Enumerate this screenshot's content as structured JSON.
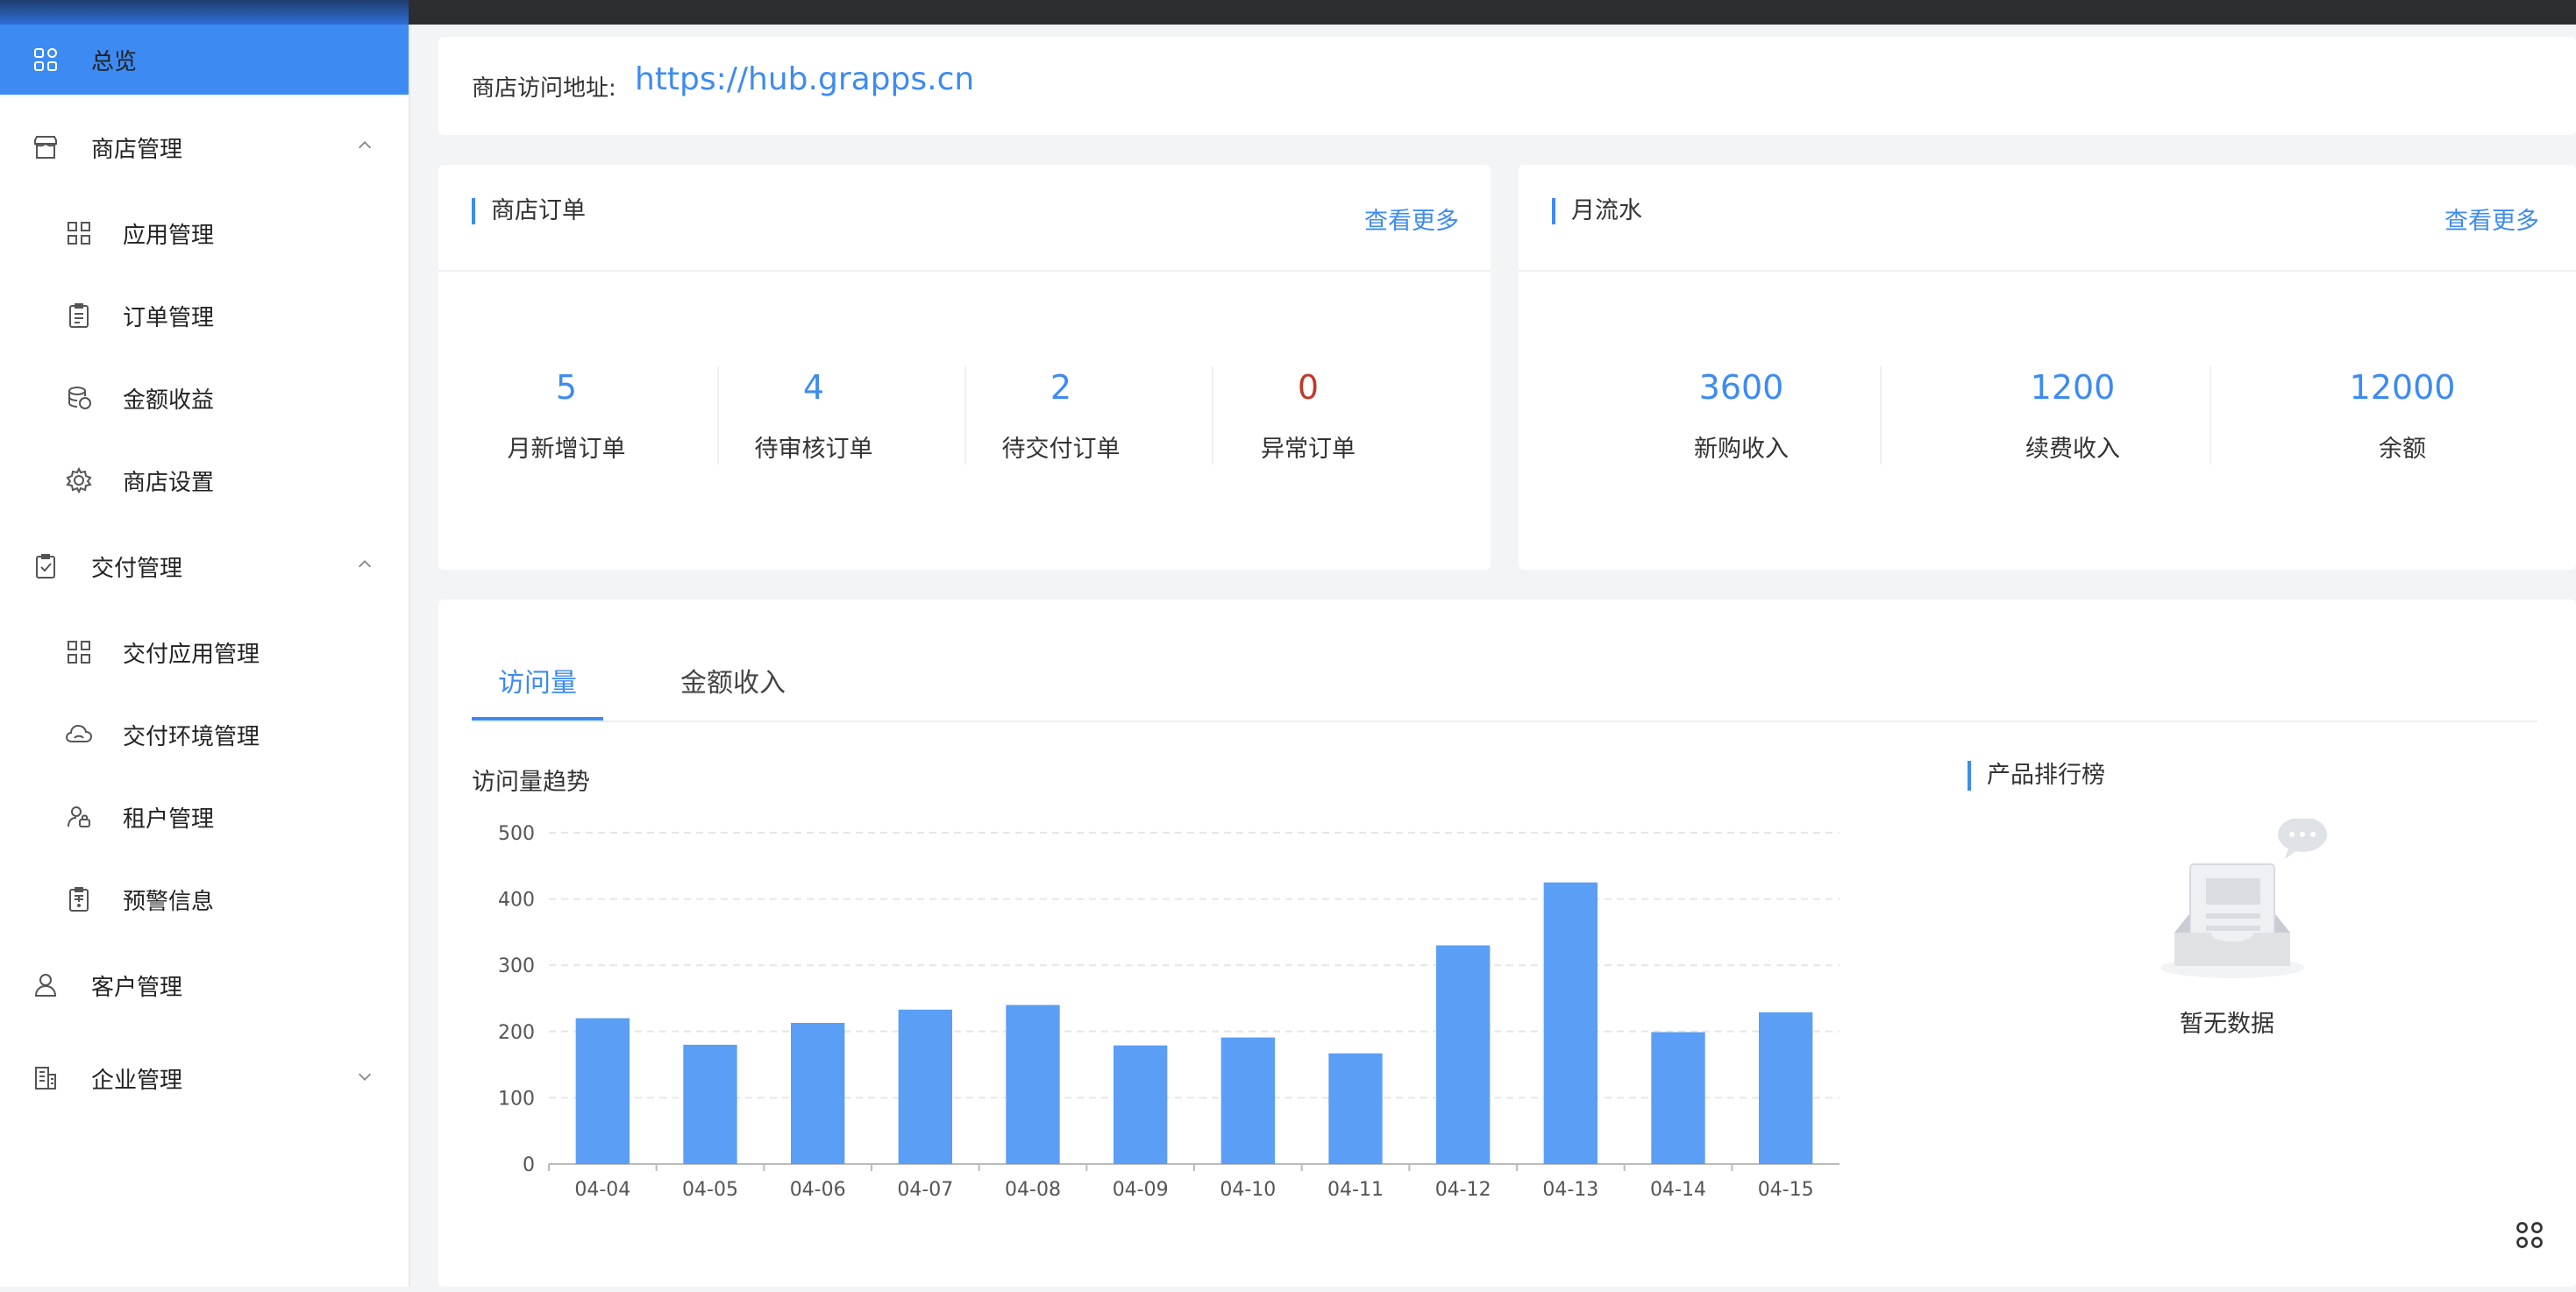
{
  "sidebar": {
    "items": [
      {
        "label": "总览",
        "icon": "overview-icon",
        "active": true
      },
      {
        "label": "商店管理",
        "icon": "store-icon",
        "expanded": true
      },
      {
        "label": "应用管理",
        "icon": "apps-icon"
      },
      {
        "label": "订单管理",
        "icon": "order-icon"
      },
      {
        "label": "金额收益",
        "icon": "coins-icon"
      },
      {
        "label": "商店设置",
        "icon": "gear-icon"
      },
      {
        "label": "交付管理",
        "icon": "delivery-icon",
        "expanded": true
      },
      {
        "label": "交付应用管理",
        "icon": "apps-icon"
      },
      {
        "label": "交付环境管理",
        "icon": "cloud-icon"
      },
      {
        "label": "租户管理",
        "icon": "tenant-icon"
      },
      {
        "label": "预警信息",
        "icon": "alert-icon"
      },
      {
        "label": "客户管理",
        "icon": "customer-icon"
      },
      {
        "label": "企业管理",
        "icon": "building-icon",
        "expanded": false
      }
    ]
  },
  "store_url": {
    "label": "商店访问地址:",
    "url": "https://hub.grapps.cn"
  },
  "orders_card": {
    "title": "商店订单",
    "more": "查看更多",
    "stats": [
      {
        "value": "5",
        "label": "月新增订单"
      },
      {
        "value": "4",
        "label": "待审核订单"
      },
      {
        "value": "2",
        "label": "待交付订单"
      },
      {
        "value": "0",
        "label": "异常订单"
      }
    ]
  },
  "flow_card": {
    "title": "月流水",
    "more": "查看更多",
    "stats": [
      {
        "value": "3600",
        "label": "新购收入"
      },
      {
        "value": "1200",
        "label": "续费收入"
      },
      {
        "value": "12000",
        "label": "余额"
      }
    ]
  },
  "tabs": [
    {
      "label": "访问量",
      "active": true
    },
    {
      "label": "金额收入",
      "active": false
    }
  ],
  "chart_title": "访问量趋势",
  "ranking": {
    "title": "产品排行榜",
    "empty": "暂无数据"
  },
  "colors": {
    "accent": "#3d8bf2",
    "bar": "#5b9ef5",
    "danger": "#c0392b"
  },
  "chart_data": {
    "type": "bar",
    "categories": [
      "04-04",
      "04-05",
      "04-06",
      "04-07",
      "04-08",
      "04-09",
      "04-10",
      "04-11",
      "04-12",
      "04-13",
      "04-14",
      "04-15"
    ],
    "values": [
      220,
      180,
      213,
      233,
      240,
      179,
      191,
      167,
      330,
      425,
      199,
      229
    ],
    "yticks": [
      0,
      100,
      200,
      300,
      400,
      500
    ],
    "ylim": [
      0,
      500
    ],
    "grid": true
  }
}
